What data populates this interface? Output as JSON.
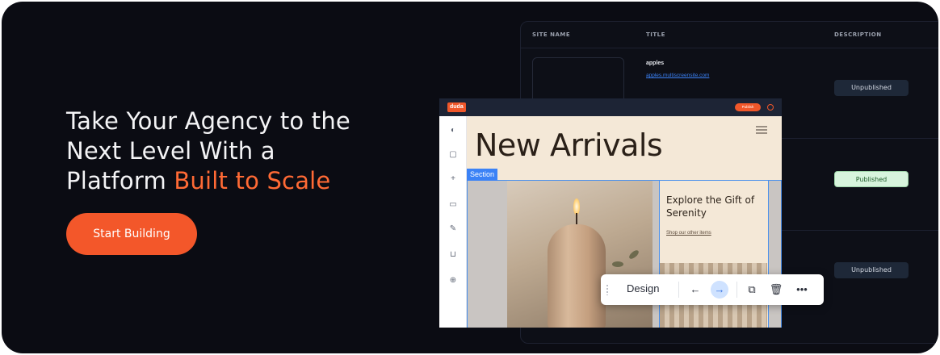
{
  "hero": {
    "headline_line1": "Take Your Agency to the",
    "headline_line2": "Next Level With a",
    "headline_line3_plain": "Platform ",
    "headline_line3_accent": "Built to Scale",
    "cta_label": "Start Building"
  },
  "table": {
    "columns": [
      "SITE NAME",
      "TITLE",
      "DESCRIPTION"
    ],
    "rows": [
      {
        "name": "apples",
        "url": "apples.multiscreensite.com",
        "status": "Unpublished"
      },
      {
        "status": "Published"
      },
      {
        "status": "Unpublished"
      }
    ]
  },
  "editor": {
    "logo": "duda",
    "top_button": "Publish",
    "sidebar_icons": [
      "palette-icon",
      "page-icon",
      "plus-icon",
      "folder-icon",
      "brush-icon",
      "cart-icon",
      "globe-icon"
    ],
    "page_title": "New Arrivals",
    "section_label": "Section",
    "card_title": "Explore the Gift of Serenity",
    "card_link": "Shop our other items"
  },
  "toolbar": {
    "design_label": "Design",
    "arrow_left": "←",
    "arrow_right": "→",
    "copy": "⧉",
    "delete": "🗑",
    "more": "•••"
  },
  "colors": {
    "background": "#0b0c13",
    "accent": "#ff6a35",
    "cta": "#f3572a",
    "selection": "#3b82f6"
  }
}
